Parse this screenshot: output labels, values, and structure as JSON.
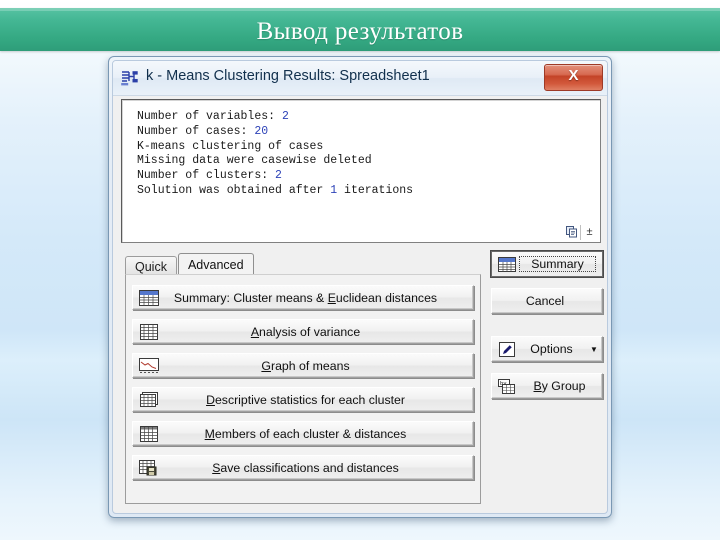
{
  "slide": {
    "header_title": "Вывод результатов"
  },
  "dialog": {
    "title": "k - Means Clustering Results: Spreadsheet1",
    "title_icon": "cluster-tree-icon",
    "close_label": "X",
    "output": {
      "lines": [
        {
          "label": "Number of variables: ",
          "value": "2"
        },
        {
          "label": "Number of cases: ",
          "value": "20"
        },
        {
          "label": "K-means clustering of cases",
          "value": ""
        },
        {
          "label": "Missing data were casewise deleted",
          "value": ""
        },
        {
          "label": "Number of clusters: ",
          "value": "2"
        },
        {
          "label": "Solution was obtained after ",
          "value": "1",
          "suffix": " iterations"
        }
      ],
      "tools": [
        {
          "name": "copy-icon",
          "glyph": ""
        },
        {
          "name": "plus-minus-icon",
          "glyph": "±"
        }
      ]
    },
    "tabs": [
      {
        "label": "Quick",
        "active": false
      },
      {
        "label": "Advanced",
        "active": true
      }
    ],
    "action_buttons": [
      {
        "icon": "summary-spreadsheet-icon",
        "pre": "Summary: Cluster means & ",
        "mnemonic": "E",
        "post": "uclidean distances"
      },
      {
        "icon": "grid-icon",
        "pre": "",
        "mnemonic": "A",
        "post": "nalysis of variance"
      },
      {
        "icon": "line-chart-icon",
        "pre": "",
        "mnemonic": "G",
        "post": "raph of means"
      },
      {
        "icon": "stacked-grid-icon",
        "pre": "",
        "mnemonic": "D",
        "post": "escriptive statistics for each cluster"
      },
      {
        "icon": "members-grid-icon",
        "pre": "",
        "mnemonic": "M",
        "post": "embers of each cluster & distances"
      },
      {
        "icon": "save-grid-icon",
        "pre": "",
        "mnemonic": "S",
        "post": "ave classifications and distances"
      }
    ],
    "side_buttons": [
      {
        "icon": "summary-spreadsheet-icon",
        "label": "Summary",
        "focused": true,
        "caret": false
      },
      {
        "icon": null,
        "label": "Cancel",
        "focused": false,
        "caret": false
      },
      {
        "icon": "options-wrench-icon",
        "label": "Options",
        "focused": false,
        "caret": true
      },
      {
        "icon": "by-group-icon",
        "pre": "",
        "mnemonic": "B",
        "post": "y Group",
        "label": "By Group",
        "focused": false,
        "caret": false
      }
    ]
  },
  "colors": {
    "band_green": "#3bb191",
    "close_red": "#c44428",
    "output_number_blue": "#2e43b8"
  }
}
